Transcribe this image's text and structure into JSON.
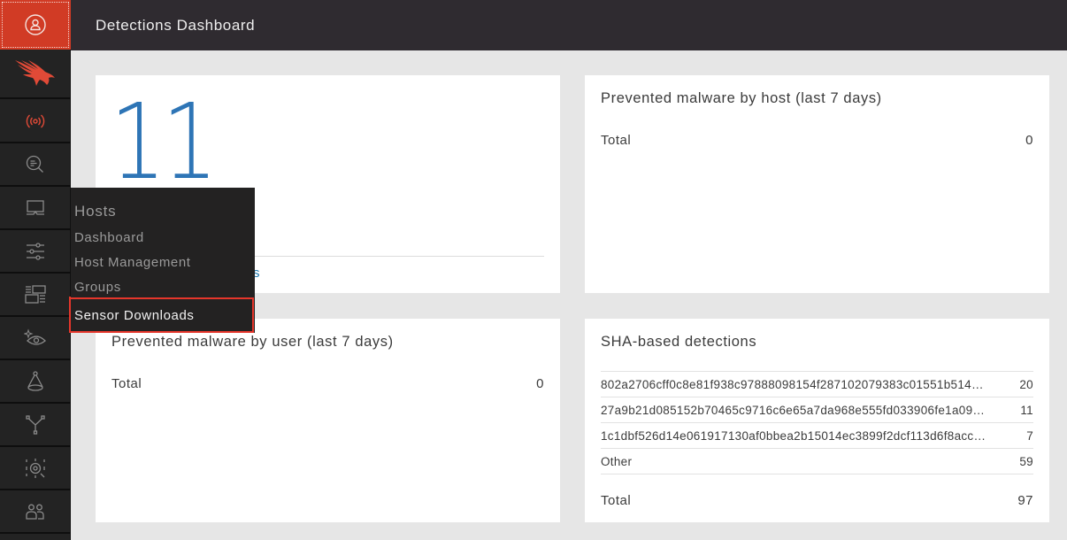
{
  "header": {
    "title": "Detections Dashboard"
  },
  "sidebar": {
    "brand_color": "#d13b25",
    "items": [
      {
        "icon": "user-profile-icon",
        "active": true
      },
      {
        "icon": "falcon-logo-icon"
      },
      {
        "icon": "activity-broadcast-icon"
      },
      {
        "icon": "investigate-search-icon"
      },
      {
        "icon": "hosts-monitor-icon"
      },
      {
        "icon": "configuration-sliders-icon"
      },
      {
        "icon": "dashboards-layout-icon"
      },
      {
        "icon": "discover-eye-icon"
      },
      {
        "icon": "spotlight-cone-icon"
      },
      {
        "icon": "workflow-nodes-icon"
      },
      {
        "icon": "intelligence-target-icon"
      },
      {
        "icon": "users-icon"
      }
    ]
  },
  "flyout": {
    "heading": "Hosts",
    "items": [
      {
        "label": "Dashboard"
      },
      {
        "label": "Host Management"
      },
      {
        "label": "Groups"
      },
      {
        "label": "Sensor Downloads",
        "highlighted": true
      }
    ]
  },
  "cards": {
    "detections_count": {
      "value": "11",
      "link_primary_fragment": "s",
      "link_secondary_fragment": "s"
    },
    "malware_by_host": {
      "title": "Prevented malware by host (last 7 days)",
      "total_label": "Total",
      "total_value": "0"
    },
    "malware_by_user": {
      "title": "Prevented malware by user (last 7 days)",
      "total_label": "Total",
      "total_value": "0"
    },
    "sha_detections": {
      "title": "SHA-based detections",
      "rows": [
        {
          "hash": "802a2706cff0c8e81f938c97888098154f287102079383c01551b514…",
          "count": "20"
        },
        {
          "hash": "27a9b21d085152b70465c9716c6e65a7da968e555fd033906fe1a09…",
          "count": "11"
        },
        {
          "hash": "1c1dbf526d14e061917130af0bbea2b15014ec3899f2dcf113d6f8acc2…",
          "count": "7"
        },
        {
          "hash": "Other",
          "count": "59"
        }
      ],
      "total_label": "Total",
      "total_value": "97"
    }
  }
}
